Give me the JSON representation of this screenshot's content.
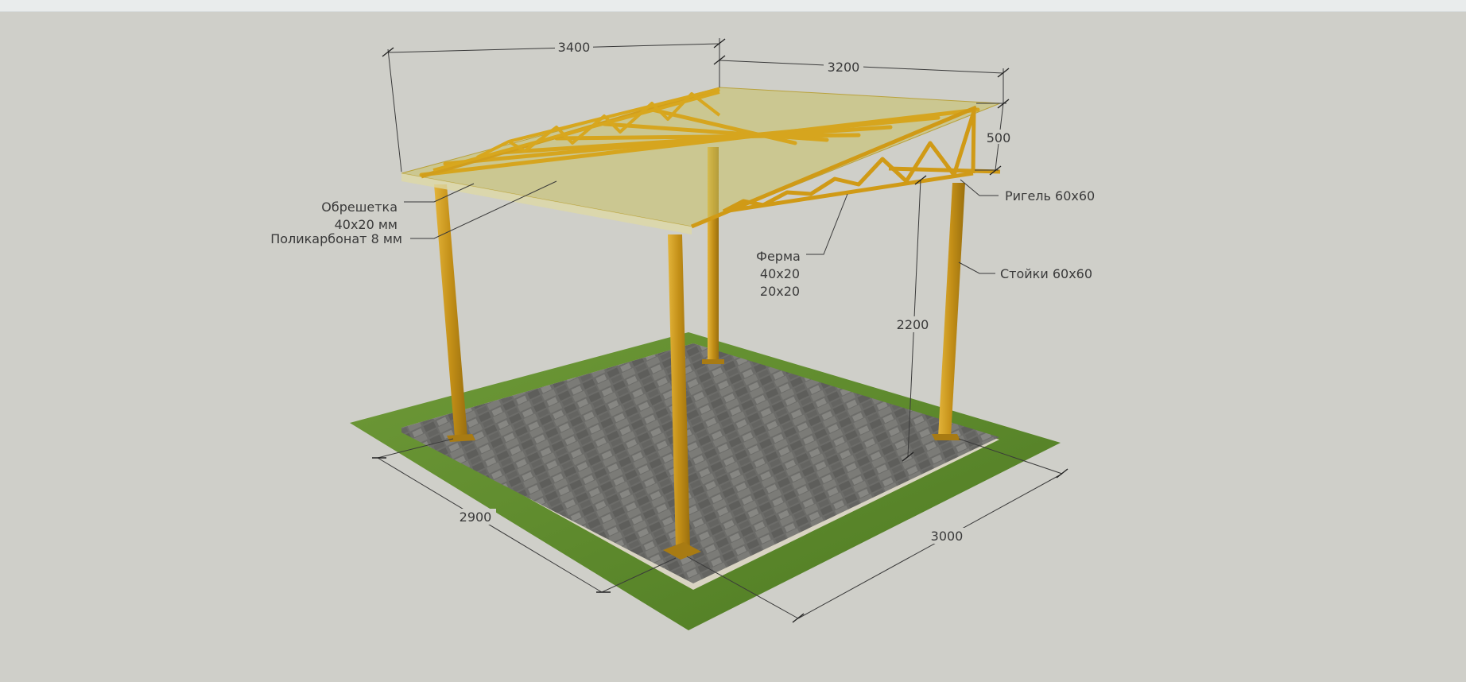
{
  "dimensions": {
    "roof_length": "3400",
    "roof_width": "3200",
    "truss_height": "500",
    "post_height": "2200",
    "base_width": "2900",
    "base_length": "3000"
  },
  "labels": {
    "lathing_line1": "Обрешетка",
    "lathing_line2": "40х20 мм",
    "polycarbonate": "Поликарбонат 8 мм",
    "girder": "Ригель 60х60",
    "truss_line1": "Ферма",
    "truss_line2": "40х20",
    "truss_line3": "20х20",
    "posts": "Стойки 60х60"
  },
  "colors": {
    "background": "#cfcfc9",
    "grass": "#5f8a2f",
    "paving": "#6f6f6c",
    "steel": "#c9961c",
    "polycarbonate": "#c9c163"
  }
}
